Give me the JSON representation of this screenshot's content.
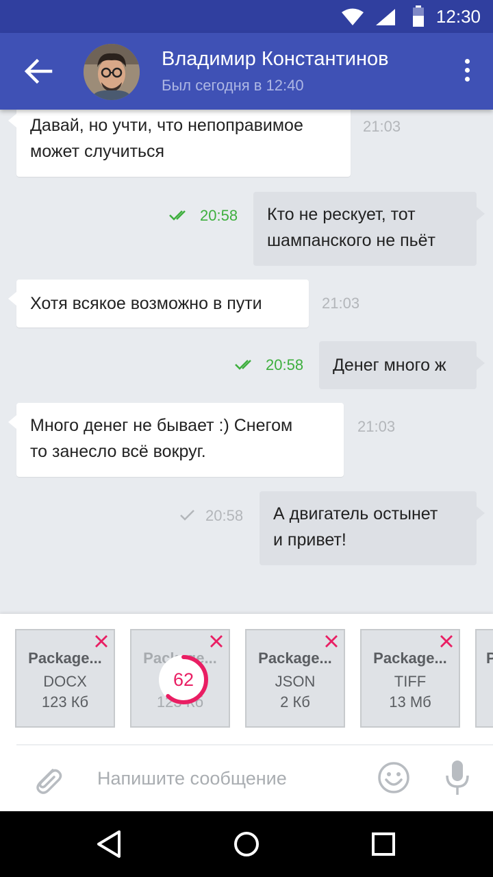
{
  "status_bar": {
    "time": "12:30"
  },
  "header": {
    "contact_name": "Владимир Константинов",
    "contact_status": "Был сегодня в 12:40"
  },
  "messages": [
    {
      "direction": "in",
      "text_line1": "Давай, но учти, что непоправимое",
      "text_line2": "может случиться",
      "time": "21:03"
    },
    {
      "direction": "out",
      "text_line1": "Кто не рескует, тот",
      "text_line2": "шампанского не пьёт",
      "time": "20:58",
      "status": "read"
    },
    {
      "direction": "in",
      "text_line1": "Хотя всякое возможно в пути",
      "time": "21:03"
    },
    {
      "direction": "out",
      "text_line1": "Денег много ж",
      "time": "20:58",
      "status": "read"
    },
    {
      "direction": "in",
      "text_line1": "Много денег не бывает :)  Снегом",
      "text_line2": "то занесло всё вокруг.",
      "time": "21:03"
    },
    {
      "direction": "out",
      "text_line1": "А двигатель остынет",
      "text_line2": "и привет!",
      "time": "20:58",
      "status": "sent"
    }
  ],
  "attachments": [
    {
      "name": "Package...",
      "type": "DOCX",
      "size": "123 Кб"
    },
    {
      "name": "Package...",
      "type": "",
      "size": "123 Кб",
      "upload_progress": 62
    },
    {
      "name": "Package...",
      "type": "JSON",
      "size": "2 Кб"
    },
    {
      "name": "Package...",
      "type": "TIFF",
      "size": "13 Мб"
    },
    {
      "name": "P"
    }
  ],
  "composer": {
    "placeholder": "Напишите сообщение"
  },
  "colors": {
    "status_bar": "#303f9f",
    "toolbar": "#3f51b5",
    "read_time": "#3eaf3e",
    "accent": "#e91e63",
    "chat_background": "#e8ebef"
  },
  "icons": {
    "back": "arrow-left-icon",
    "menu": "more-vert-icon",
    "attach": "paperclip-icon",
    "emoji": "smiley-icon",
    "mic": "microphone-icon",
    "remove": "close-icon",
    "read": "double-check-icon",
    "sent": "check-icon"
  }
}
